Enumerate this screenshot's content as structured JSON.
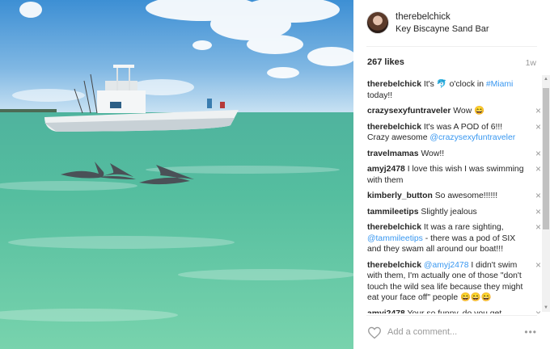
{
  "post": {
    "username": "therebelchick",
    "location": "Key Biscayne Sand Bar",
    "likes": "267 likes",
    "time_ago": "1w"
  },
  "comments": [
    {
      "user": "therebelchick",
      "parts": [
        {
          "t": "It's "
        },
        {
          "t": "🐬",
          "k": "emoji"
        },
        {
          "t": " o'clock in "
        },
        {
          "t": "#Miami",
          "k": "link"
        },
        {
          "t": " today!!"
        }
      ],
      "closable": false
    },
    {
      "user": "crazysexyfuntraveler",
      "parts": [
        {
          "t": "Wow 😄"
        }
      ],
      "closable": true
    },
    {
      "user": "therebelchick",
      "parts": [
        {
          "t": "It's was A POD of 6!!! Crazy awesome "
        },
        {
          "t": "@crazysexyfuntraveler",
          "k": "link"
        }
      ],
      "closable": true
    },
    {
      "user": "travelmamas",
      "parts": [
        {
          "t": "Wow!!"
        }
      ],
      "closable": true
    },
    {
      "user": "amyj2478",
      "parts": [
        {
          "t": "I love this wish I was swimming with them"
        }
      ],
      "closable": true
    },
    {
      "user": "kimberly_button",
      "parts": [
        {
          "t": "So awesome!!!!!!"
        }
      ],
      "closable": true
    },
    {
      "user": "tammileetips",
      "parts": [
        {
          "t": "Slightly jealous"
        }
      ],
      "closable": true
    },
    {
      "user": "therebelchick",
      "parts": [
        {
          "t": "It was a rare sighting, "
        },
        {
          "t": "@tammileetips",
          "k": "link"
        },
        {
          "t": " - there was a pod of SIX and they swam all around our boat!!!"
        }
      ],
      "closable": true
    },
    {
      "user": "therebelchick",
      "parts": [
        {
          "t": "@amyj2478",
          "k": "link"
        },
        {
          "t": " I didn't swim with them, I'm actually one of those \"don't touch the wild sea life because they might eat your face off\" people 😄😄😄"
        }
      ],
      "closable": true
    },
    {
      "user": "amyj2478",
      "parts": [
        {
          "t": "Your so funny, do you get"
        }
      ],
      "closable": true
    }
  ],
  "add_comment_placeholder": "Add a comment...",
  "icons": {
    "close": "×",
    "more": "•••",
    "scroll_up": "▲",
    "scroll_down": "▼",
    "heart": "heart-outline"
  }
}
